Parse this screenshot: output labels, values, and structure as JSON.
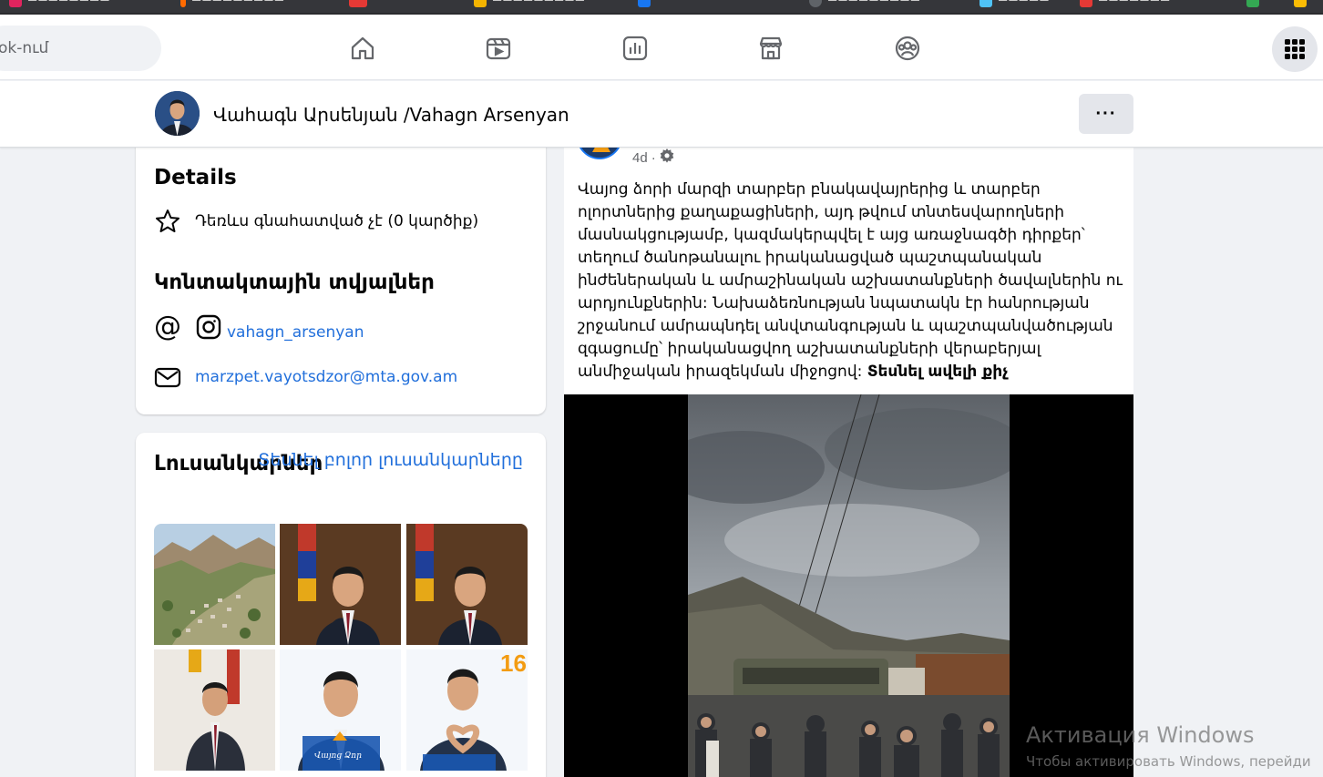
{
  "browser": {
    "bookmark_colors": [
      "#e0245e",
      "#ff6a00",
      "#e53935",
      "#f4b400",
      "#1877f2",
      "#5f6368",
      "#4fc3f7",
      "#e53935",
      "#34a853"
    ]
  },
  "topnav": {
    "search_placeholder": "ok-ում",
    "icons": [
      "home-icon",
      "watch-icon",
      "ads-manager-icon",
      "marketplace-icon",
      "groups-icon"
    ],
    "menu_icon": "apps-grid-icon"
  },
  "profile": {
    "name": "Վահագն Արսենյան /Vahagn Arsenyan",
    "more_label": "···"
  },
  "details": {
    "title": "Details",
    "rating": "Դեռևս գնահատված չէ (0 կարծիք)",
    "contacts_title": "Կոնտակտային տվյալներ",
    "instagram": "vahagn_arsenyan",
    "email": "marzpet.vayotsdzor@mta.gov.am"
  },
  "photos": {
    "title": "Լուսանկարներ",
    "see_all": "Տեսնել բոլոր լուսանկարները",
    "badge_number": "16",
    "caption_text": "Վայոց Ձոր"
  },
  "post": {
    "time": "4d",
    "text": "Վայոց ձորի մարզի տարբեր բնակավայրերից և տարբեր ոլորտներից քաղաքացիների, այդ թվում տնտեսվարողների մասնակցությամբ, կազմակերպվել է այց առաջնագծի դիրքեր՝ տեղում ծանոթանալու իրականացված պաշտպանական ինժեներական և ամրաշինական աշխատանքների ծավալներին ու արդյունքներին: Նախաձեռնության նպատակն էր հանրության շրջանում ամրապնդել անվտանգության և պաշտպանվածության զգացումը՝ իրականացվող աշխատանքների վերաբերյալ անմիջական իրազեկման միջոցով:",
    "see_more": "Տեսնել ավելի քիչ"
  },
  "watermark": {
    "line1": "Активация Windows",
    "line2": "Чтобы активировать Windows, перейди"
  },
  "colors": {
    "fb_blue": "#1877f2",
    "link": "#216fdb",
    "background": "#f0f2f5"
  }
}
